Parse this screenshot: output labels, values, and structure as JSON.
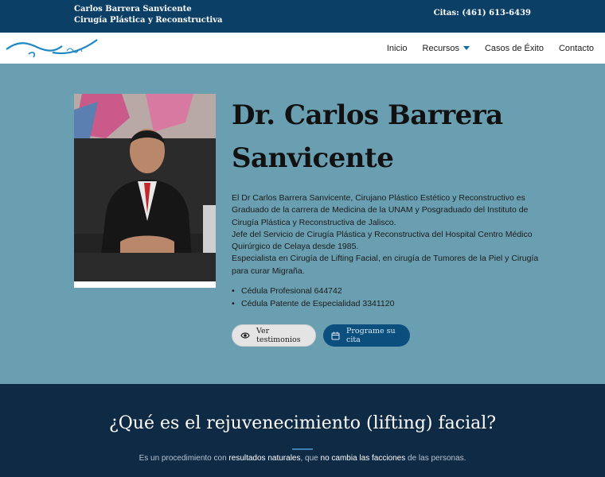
{
  "topbar": {
    "brand_line1": "Carlos Barrera Sanvicente",
    "brand_line2": "Cirugía Plástica y Reconstructiva",
    "phone": "Citas: (461) 613-6439"
  },
  "nav": {
    "items": [
      {
        "label": "Inicio"
      },
      {
        "label": "Recursos",
        "has_dropdown": true
      },
      {
        "label": "Casos de Éxito"
      },
      {
        "label": "Contacto"
      }
    ]
  },
  "hero": {
    "title": "Dr. Carlos Barrera Sanvicente",
    "bio": [
      "El Dr Carlos Barrera Sanvicente, Cirujano Plástico Estético y Reconstructivo es Graduado de la carrera de Medicina de la UNAM y Posgraduado del Instituto de Cirugía Plástica y Reconstructiva de Jalisco.",
      "Jefe del Servicio de Cirugía Plástica y Reconstructiva del Hospital Centro Médico Quirúrgico de Celaya desde 1985.",
      "Especialista en Cirugía de Lifting Facial, en cirugía de Tumores de la Piel y Cirugía para curar Migraña."
    ],
    "credentials": [
      "Cédula Profesional 644742",
      "Cédula Patente de Especialidad 3341120"
    ],
    "btn_testimonios": "Ver testimonios",
    "btn_cita": "Programe su cita"
  },
  "section": {
    "title": "¿Qué es el rejuvenecimiento (lifting) facial?",
    "intro_1": "Es un procedimiento con ",
    "intro_hl1": "resultados naturales",
    "intro_2": ", que ",
    "intro_hl2": "no cambia las facciones",
    "intro_3": " de las personas."
  },
  "colors": {
    "topbar": "#0b3f66",
    "hero_bg": "#6a9fb1",
    "section_bg": "#0f2a45",
    "accent": "#0b4f7e"
  }
}
